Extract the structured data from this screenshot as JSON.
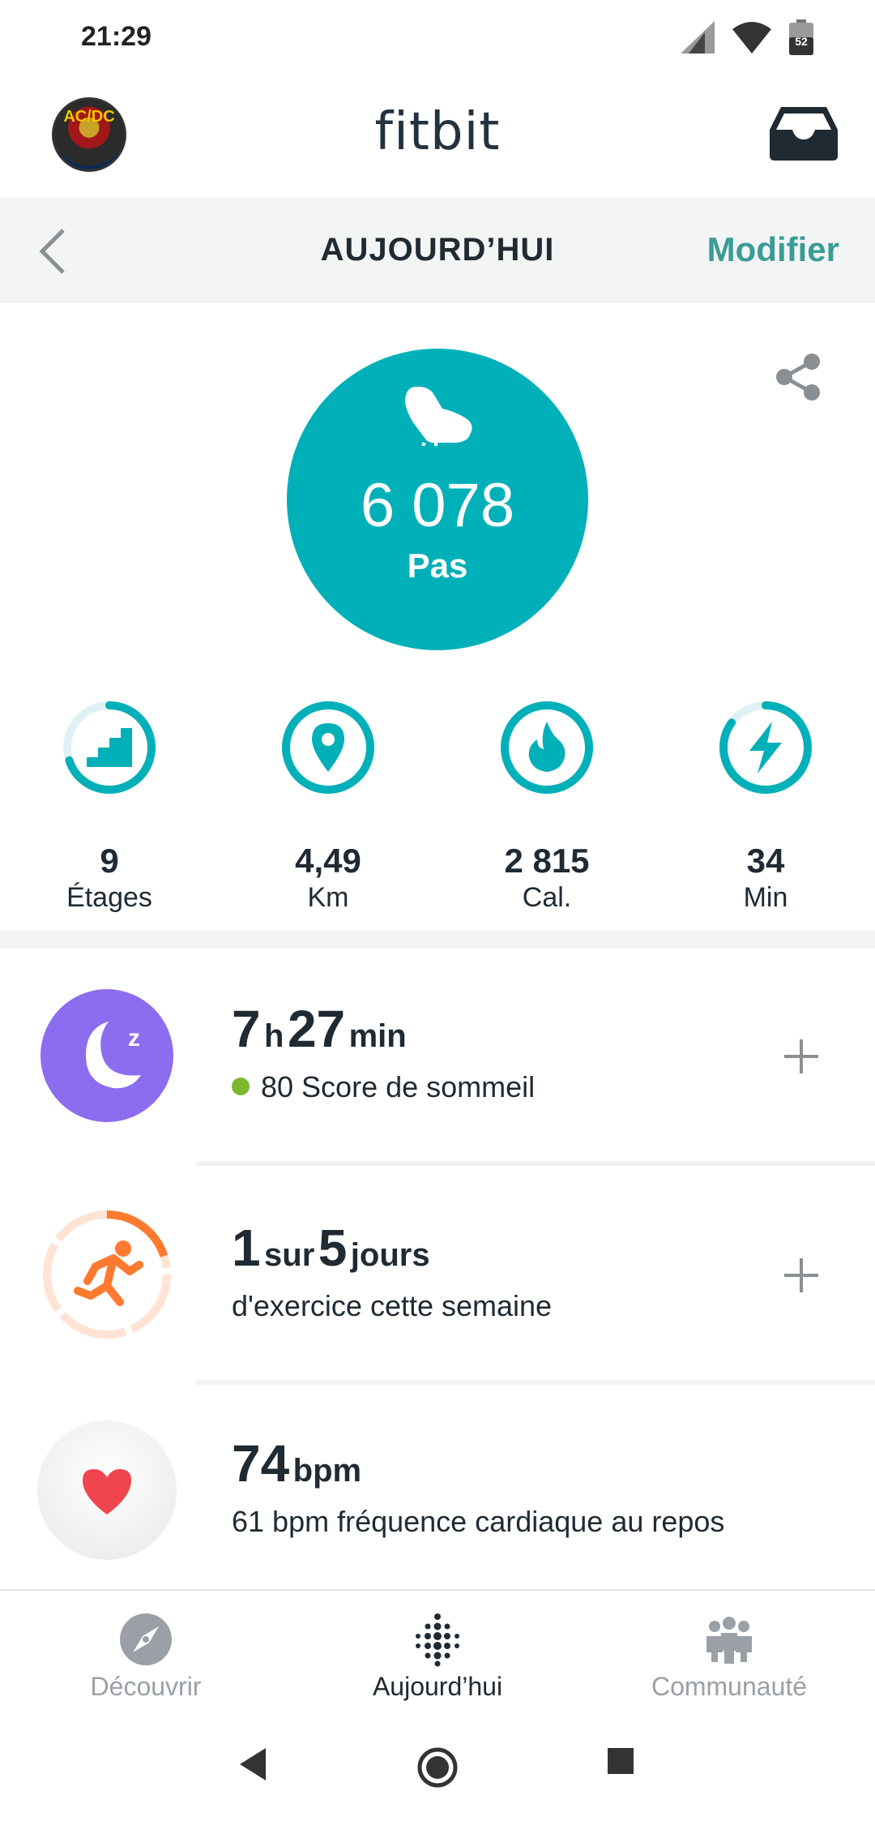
{
  "status_bar": {
    "time": "21:29",
    "battery_level": "52"
  },
  "header": {
    "logo_text": "fitbit",
    "avatar_text": "AC/DC"
  },
  "date_bar": {
    "title": "AUJOURD’HUI",
    "edit_label": "Modifier"
  },
  "steps": {
    "value": "6 078",
    "label": "Pas",
    "color": "#00b0b9"
  },
  "metrics": [
    {
      "value": "9",
      "label": "Étages",
      "icon": "stairs-icon",
      "progress": 0.7
    },
    {
      "value": "4,49",
      "label": "Km",
      "icon": "location-pin-icon",
      "progress": 1.0
    },
    {
      "value": "2 815",
      "label": "Cal.",
      "icon": "flame-icon",
      "progress": 1.0
    },
    {
      "value": "34",
      "label": "Min",
      "icon": "lightning-icon",
      "progress": 0.85
    }
  ],
  "sleep": {
    "hours": "7",
    "hours_unit": "h",
    "minutes": "27",
    "minutes_unit": "min",
    "score_text": "80 Score de sommeil",
    "color": "#8c6df0"
  },
  "exercise": {
    "count": "1",
    "sur": "sur",
    "goal": "5",
    "unit": "jours",
    "subtitle": "d'exercice cette semaine",
    "color": "#ff7a2f",
    "progress": 0.2
  },
  "heart": {
    "value": "74",
    "unit": "bpm",
    "subtitle": "61 bpm fréquence cardiaque au repos",
    "color": "#f0454f"
  },
  "bottom_nav": {
    "items": [
      {
        "label": "Découvrir",
        "icon": "compass-icon",
        "active": false
      },
      {
        "label": "Aujourd’hui",
        "icon": "fitbit-dots-icon",
        "active": true
      },
      {
        "label": "Communauté",
        "icon": "community-icon",
        "active": false
      }
    ]
  }
}
